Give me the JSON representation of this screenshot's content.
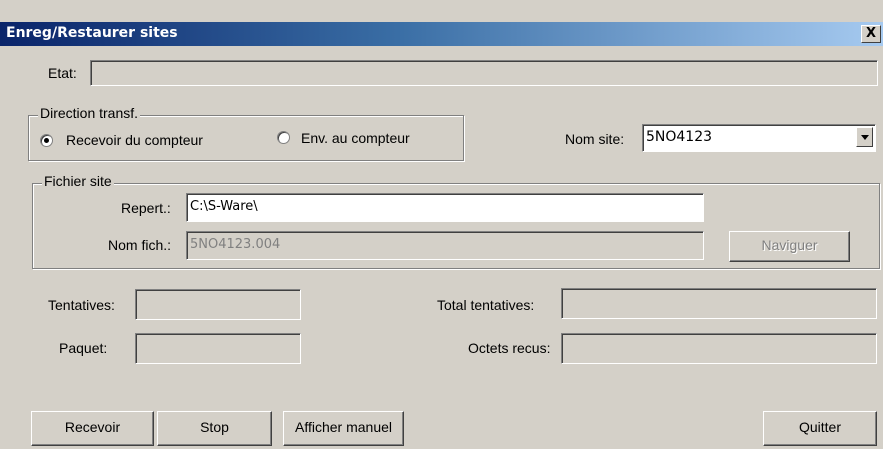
{
  "window": {
    "title": "Enreg/Restaurer sites",
    "close_label": "X"
  },
  "etat": {
    "label": "Etat:",
    "value": ""
  },
  "direction": {
    "title": "Direction transf.",
    "options": [
      {
        "label": "Recevoir du compteur",
        "selected": true
      },
      {
        "label": "Env. au compteur",
        "selected": false
      }
    ]
  },
  "nom_site": {
    "label": "Nom site:",
    "value": "5NO4123"
  },
  "fichier": {
    "title": "Fichier site",
    "repert_label": "Repert.:",
    "repert_value": "C:\\S-Ware\\",
    "nomfich_label": "Nom fich.:",
    "nomfich_value": "5NO4123.004",
    "naviguer_label": "Naviguer"
  },
  "stats": {
    "tentatives_label": "Tentatives:",
    "tentatives_value": "",
    "paquet_label": "Paquet:",
    "paquet_value": "",
    "total_label": "Total tentatives:",
    "total_value": "",
    "octets_label": "Octets recus:",
    "octets_value": ""
  },
  "buttons": {
    "recevoir": "Recevoir",
    "stop": "Stop",
    "afficher": "Afficher manuel",
    "quitter": "Quitter"
  }
}
